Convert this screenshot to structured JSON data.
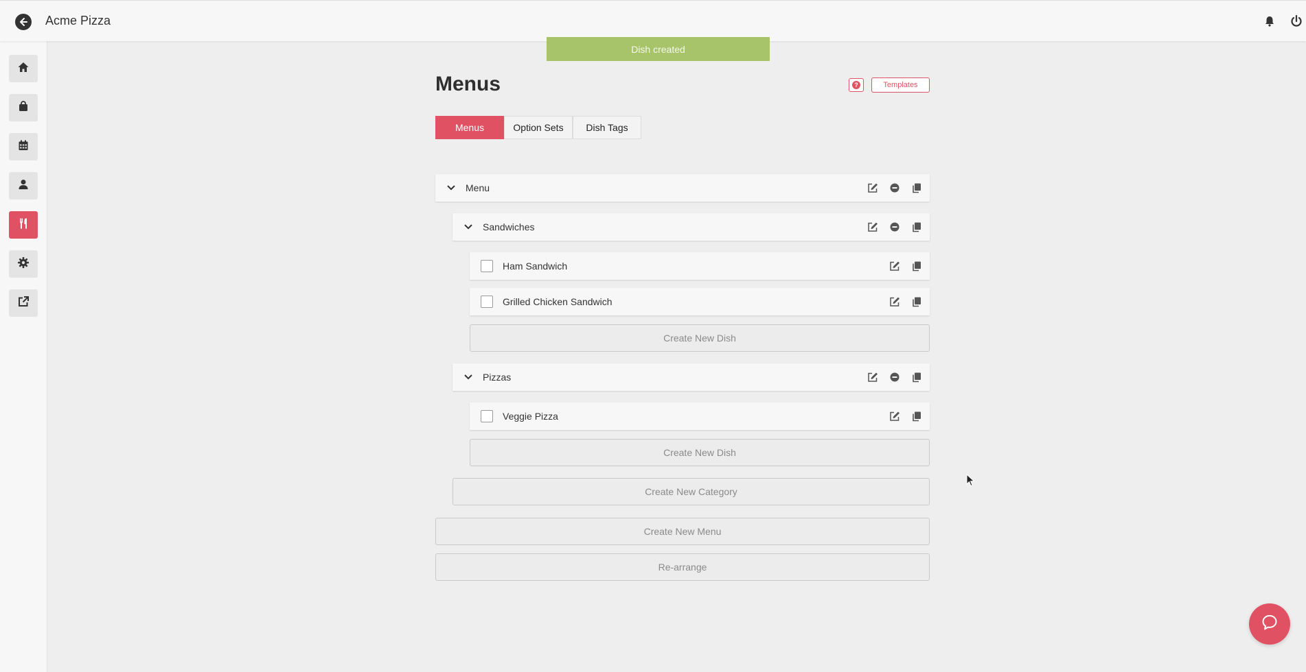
{
  "app": {
    "title": "Acme Pizza"
  },
  "toast": {
    "message": "Dish created"
  },
  "page": {
    "title": "Menus",
    "templates_label": "Templates",
    "help_label": "?"
  },
  "tabs": [
    {
      "label": "Menus",
      "active": true
    },
    {
      "label": "Option Sets",
      "active": false
    },
    {
      "label": "Dish Tags",
      "active": false
    }
  ],
  "sidebar": {
    "items": [
      {
        "icon": "home-icon"
      },
      {
        "icon": "shopping-bag-icon"
      },
      {
        "icon": "calendar-icon"
      },
      {
        "icon": "user-icon"
      },
      {
        "icon": "utensils-icon",
        "active": true
      },
      {
        "icon": "gear-icon"
      },
      {
        "icon": "external-link-icon"
      }
    ]
  },
  "menu_tree": {
    "menu_name": "Menu",
    "categories": [
      {
        "name": "Sandwiches",
        "dishes": [
          "Ham Sandwich",
          "Grilled Chicken Sandwich"
        ],
        "create_dish_label": "Create New Dish"
      },
      {
        "name": "Pizzas",
        "dishes": [
          "Veggie Pizza"
        ],
        "create_dish_label": "Create New Dish"
      }
    ],
    "create_category_label": "Create New Category",
    "create_menu_label": "Create New Menu",
    "rearrange_label": "Re-arrange"
  },
  "colors": {
    "accent": "#e05263",
    "toast": "#a8c46a"
  }
}
